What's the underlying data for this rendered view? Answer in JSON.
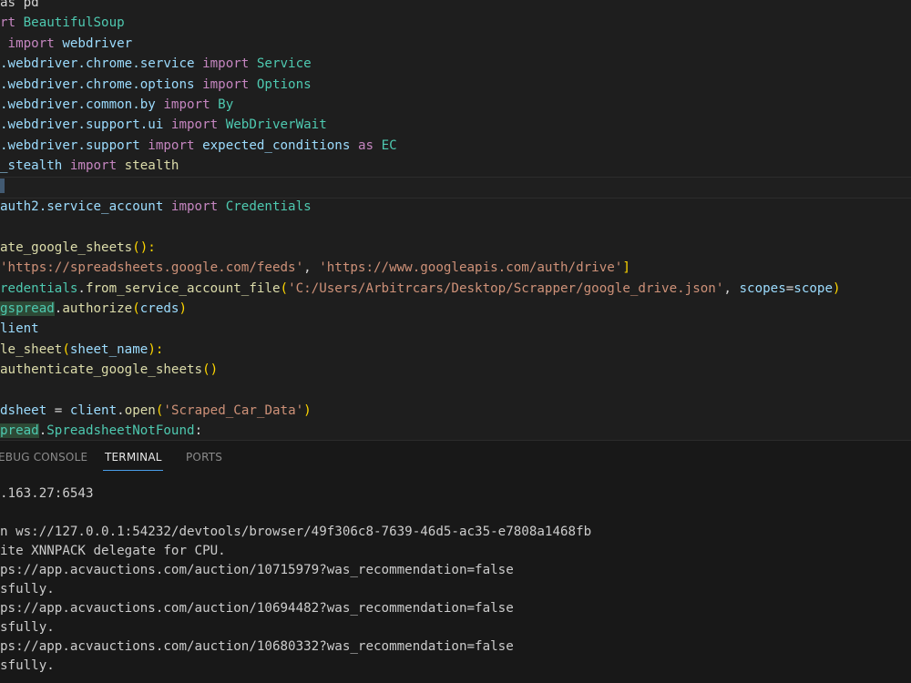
{
  "editor": {
    "lines": [
      [
        {
          "t": "as pd",
          "c": "t-op"
        }
      ],
      [
        {
          "t": "rt ",
          "c": "t-kw"
        },
        {
          "t": "BeautifulSoup",
          "c": "t-mod"
        }
      ],
      [
        {
          "t": " import ",
          "c": "t-kw"
        },
        {
          "t": "webdriver",
          "c": "t-var"
        }
      ],
      [
        {
          "t": ".webdriver.chrome.service ",
          "c": "t-var"
        },
        {
          "t": "import ",
          "c": "t-kw"
        },
        {
          "t": "Service",
          "c": "t-mod"
        }
      ],
      [
        {
          "t": ".webdriver.chrome.options ",
          "c": "t-var"
        },
        {
          "t": "import ",
          "c": "t-kw"
        },
        {
          "t": "Options",
          "c": "t-mod"
        }
      ],
      [
        {
          "t": ".webdriver.common.by ",
          "c": "t-var"
        },
        {
          "t": "import ",
          "c": "t-kw"
        },
        {
          "t": "By",
          "c": "t-mod"
        }
      ],
      [
        {
          "t": ".webdriver.support.ui ",
          "c": "t-var"
        },
        {
          "t": "import ",
          "c": "t-kw"
        },
        {
          "t": "WebDriverWait",
          "c": "t-mod"
        }
      ],
      [
        {
          "t": ".webdriver.support ",
          "c": "t-var"
        },
        {
          "t": "import ",
          "c": "t-kw"
        },
        {
          "t": "expected_conditions ",
          "c": "t-var"
        },
        {
          "t": "as ",
          "c": "t-kw"
        },
        {
          "t": "EC",
          "c": "t-mod"
        }
      ],
      [
        {
          "t": "_stealth ",
          "c": "t-var"
        },
        {
          "t": "import ",
          "c": "t-kw"
        },
        {
          "t": "stealth",
          "c": "t-fn"
        }
      ],
      [
        {
          "t": "",
          "c": "cursor"
        }
      ],
      [
        {
          "t": "auth2.service_account ",
          "c": "t-var"
        },
        {
          "t": "import ",
          "c": "t-kw"
        },
        {
          "t": "Credentials",
          "c": "t-mod"
        }
      ],
      [],
      [
        {
          "t": "ate_google_sheets",
          "c": "t-fn"
        },
        {
          "t": "():",
          "c": "t-br"
        }
      ],
      [
        {
          "t": "'https://spreadsheets.google.com/feeds'",
          "c": "t-str"
        },
        {
          "t": ", ",
          "c": "t-op"
        },
        {
          "t": "'https://www.googleapis.com/auth/drive'",
          "c": "t-str"
        },
        {
          "t": "]",
          "c": "t-br"
        }
      ],
      [
        {
          "t": "redentials",
          "c": "t-mod"
        },
        {
          "t": ".",
          "c": "t-op"
        },
        {
          "t": "from_service_account_file",
          "c": "t-fn"
        },
        {
          "t": "(",
          "c": "t-br"
        },
        {
          "t": "'C:/Users/Arbitrcars/Desktop/Scrapper/google_drive.json'",
          "c": "t-str"
        },
        {
          "t": ", ",
          "c": "t-op"
        },
        {
          "t": "scopes",
          "c": "t-var"
        },
        {
          "t": "=",
          "c": "t-op"
        },
        {
          "t": "scope",
          "c": "t-var"
        },
        {
          "t": ")",
          "c": "t-br"
        }
      ],
      [
        {
          "t": "gspread",
          "c": "t-hl t-mod"
        },
        {
          "t": ".",
          "c": "t-op"
        },
        {
          "t": "authorize",
          "c": "t-fn"
        },
        {
          "t": "(",
          "c": "t-br"
        },
        {
          "t": "creds",
          "c": "t-var"
        },
        {
          "t": ")",
          "c": "t-br"
        }
      ],
      [
        {
          "t": "lient",
          "c": "t-var"
        }
      ],
      [
        {
          "t": "le_sheet",
          "c": "t-fn"
        },
        {
          "t": "(",
          "c": "t-br"
        },
        {
          "t": "sheet_name",
          "c": "t-var"
        },
        {
          "t": "):",
          "c": "t-br"
        }
      ],
      [
        {
          "t": "authenticate_google_sheets",
          "c": "t-fn"
        },
        {
          "t": "()",
          "c": "t-br"
        }
      ],
      [],
      [
        {
          "t": "dsheet ",
          "c": "t-var"
        },
        {
          "t": "= ",
          "c": "t-op"
        },
        {
          "t": "client",
          "c": "t-var"
        },
        {
          "t": ".",
          "c": "t-op"
        },
        {
          "t": "open",
          "c": "t-fn"
        },
        {
          "t": "(",
          "c": "t-br"
        },
        {
          "t": "'Scraped_Car_Data'",
          "c": "t-str"
        },
        {
          "t": ")",
          "c": "t-br"
        }
      ],
      [
        {
          "t": "pread",
          "c": "t-hl t-mod"
        },
        {
          "t": ".",
          "c": "t-op"
        },
        {
          "t": "SpreadsheetNotFound",
          "c": "t-mod"
        },
        {
          "t": ":",
          "c": "t-op"
        }
      ]
    ]
  },
  "panel": {
    "tabs": [
      {
        "label": "EBUG CONSOLE",
        "active": false
      },
      {
        "label": "TERMINAL",
        "active": true
      },
      {
        "label": "PORTS",
        "active": false
      }
    ]
  },
  "terminal": {
    "lines": [
      ".163.27:6543",
      "",
      "n ws://127.0.0.1:54232/devtools/browser/49f306c8-7639-46d5-ac35-e7808a1468fb",
      "ite XNNPACK delegate for CPU.",
      "ps://app.acvauctions.com/auction/10715979?was_recommendation=false",
      "sfully.",
      "ps://app.acvauctions.com/auction/10694482?was_recommendation=false",
      "sfully.",
      "ps://app.acvauctions.com/auction/10680332?was_recommendation=false",
      "sfully."
    ]
  },
  "colors": {
    "editor_bg": "#1e1e1e",
    "panel_bg": "#181818",
    "keyword": "#c586c0",
    "module": "#4ec9b0",
    "function": "#dcdcaa",
    "string": "#ce9178",
    "variable": "#9cdcfe",
    "active_tab_underline": "#4a9eea"
  }
}
